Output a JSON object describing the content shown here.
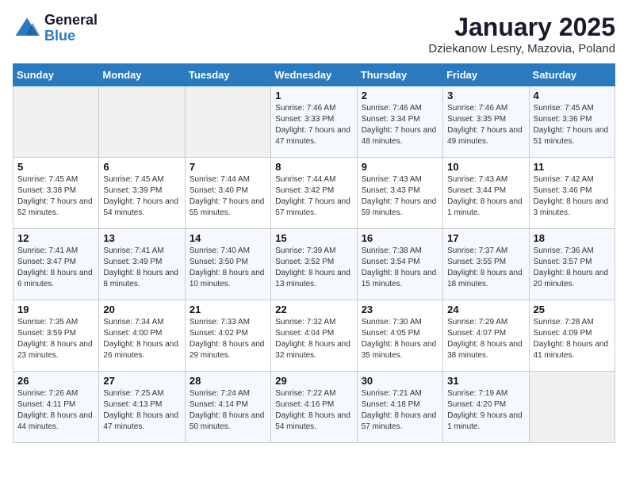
{
  "header": {
    "logo_general": "General",
    "logo_blue": "Blue",
    "month": "January 2025",
    "location": "Dziekanow Lesny, Mazovia, Poland"
  },
  "weekdays": [
    "Sunday",
    "Monday",
    "Tuesday",
    "Wednesday",
    "Thursday",
    "Friday",
    "Saturday"
  ],
  "weeks": [
    [
      {
        "day": "",
        "content": ""
      },
      {
        "day": "",
        "content": ""
      },
      {
        "day": "",
        "content": ""
      },
      {
        "day": "1",
        "content": "Sunrise: 7:46 AM\nSunset: 3:33 PM\nDaylight: 7 hours and 47 minutes."
      },
      {
        "day": "2",
        "content": "Sunrise: 7:46 AM\nSunset: 3:34 PM\nDaylight: 7 hours and 48 minutes."
      },
      {
        "day": "3",
        "content": "Sunrise: 7:46 AM\nSunset: 3:35 PM\nDaylight: 7 hours and 49 minutes."
      },
      {
        "day": "4",
        "content": "Sunrise: 7:45 AM\nSunset: 3:36 PM\nDaylight: 7 hours and 51 minutes."
      }
    ],
    [
      {
        "day": "5",
        "content": "Sunrise: 7:45 AM\nSunset: 3:38 PM\nDaylight: 7 hours and 52 minutes."
      },
      {
        "day": "6",
        "content": "Sunrise: 7:45 AM\nSunset: 3:39 PM\nDaylight: 7 hours and 54 minutes."
      },
      {
        "day": "7",
        "content": "Sunrise: 7:44 AM\nSunset: 3:40 PM\nDaylight: 7 hours and 55 minutes."
      },
      {
        "day": "8",
        "content": "Sunrise: 7:44 AM\nSunset: 3:42 PM\nDaylight: 7 hours and 57 minutes."
      },
      {
        "day": "9",
        "content": "Sunrise: 7:43 AM\nSunset: 3:43 PM\nDaylight: 7 hours and 59 minutes."
      },
      {
        "day": "10",
        "content": "Sunrise: 7:43 AM\nSunset: 3:44 PM\nDaylight: 8 hours and 1 minute."
      },
      {
        "day": "11",
        "content": "Sunrise: 7:42 AM\nSunset: 3:46 PM\nDaylight: 8 hours and 3 minutes."
      }
    ],
    [
      {
        "day": "12",
        "content": "Sunrise: 7:41 AM\nSunset: 3:47 PM\nDaylight: 8 hours and 6 minutes."
      },
      {
        "day": "13",
        "content": "Sunrise: 7:41 AM\nSunset: 3:49 PM\nDaylight: 8 hours and 8 minutes."
      },
      {
        "day": "14",
        "content": "Sunrise: 7:40 AM\nSunset: 3:50 PM\nDaylight: 8 hours and 10 minutes."
      },
      {
        "day": "15",
        "content": "Sunrise: 7:39 AM\nSunset: 3:52 PM\nDaylight: 8 hours and 13 minutes."
      },
      {
        "day": "16",
        "content": "Sunrise: 7:38 AM\nSunset: 3:54 PM\nDaylight: 8 hours and 15 minutes."
      },
      {
        "day": "17",
        "content": "Sunrise: 7:37 AM\nSunset: 3:55 PM\nDaylight: 8 hours and 18 minutes."
      },
      {
        "day": "18",
        "content": "Sunrise: 7:36 AM\nSunset: 3:57 PM\nDaylight: 8 hours and 20 minutes."
      }
    ],
    [
      {
        "day": "19",
        "content": "Sunrise: 7:35 AM\nSunset: 3:59 PM\nDaylight: 8 hours and 23 minutes."
      },
      {
        "day": "20",
        "content": "Sunrise: 7:34 AM\nSunset: 4:00 PM\nDaylight: 8 hours and 26 minutes."
      },
      {
        "day": "21",
        "content": "Sunrise: 7:33 AM\nSunset: 4:02 PM\nDaylight: 8 hours and 29 minutes."
      },
      {
        "day": "22",
        "content": "Sunrise: 7:32 AM\nSunset: 4:04 PM\nDaylight: 8 hours and 32 minutes."
      },
      {
        "day": "23",
        "content": "Sunrise: 7:30 AM\nSunset: 4:05 PM\nDaylight: 8 hours and 35 minutes."
      },
      {
        "day": "24",
        "content": "Sunrise: 7:29 AM\nSunset: 4:07 PM\nDaylight: 8 hours and 38 minutes."
      },
      {
        "day": "25",
        "content": "Sunrise: 7:28 AM\nSunset: 4:09 PM\nDaylight: 8 hours and 41 minutes."
      }
    ],
    [
      {
        "day": "26",
        "content": "Sunrise: 7:26 AM\nSunset: 4:11 PM\nDaylight: 8 hours and 44 minutes."
      },
      {
        "day": "27",
        "content": "Sunrise: 7:25 AM\nSunset: 4:13 PM\nDaylight: 8 hours and 47 minutes."
      },
      {
        "day": "28",
        "content": "Sunrise: 7:24 AM\nSunset: 4:14 PM\nDaylight: 8 hours and 50 minutes."
      },
      {
        "day": "29",
        "content": "Sunrise: 7:22 AM\nSunset: 4:16 PM\nDaylight: 8 hours and 54 minutes."
      },
      {
        "day": "30",
        "content": "Sunrise: 7:21 AM\nSunset: 4:18 PM\nDaylight: 8 hours and 57 minutes."
      },
      {
        "day": "31",
        "content": "Sunrise: 7:19 AM\nSunset: 4:20 PM\nDaylight: 9 hours and 1 minute."
      },
      {
        "day": "",
        "content": ""
      }
    ]
  ]
}
